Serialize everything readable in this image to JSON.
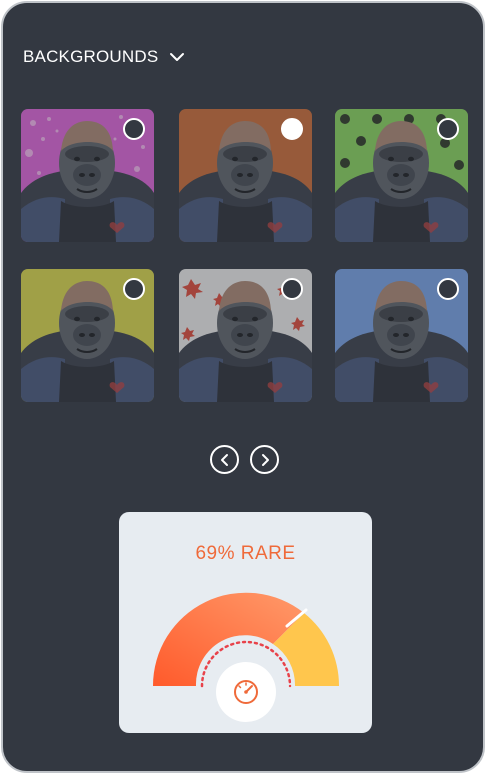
{
  "header": {
    "title": "BACKGROUNDS",
    "toggle_icon": "chevron-down-icon"
  },
  "backgrounds": [
    {
      "style": "pink-splatter",
      "color": "#c95fc6",
      "selected": false
    },
    {
      "style": "orange",
      "color": "#b86638",
      "selected": true
    },
    {
      "style": "green-polka-dot",
      "color": "#7ec05a",
      "selected": false
    },
    {
      "style": "yellow",
      "color": "#c5c34a",
      "selected": false
    },
    {
      "style": "maple-leaves",
      "color": "#d6d6d6",
      "selected": false
    },
    {
      "style": "blue",
      "color": "#6f95d1",
      "selected": false
    }
  ],
  "pagination": {
    "prev_icon": "chevron-left-icon",
    "next_icon": "chevron-right-icon"
  },
  "rarity": {
    "label": "69% RARE",
    "percent": 69,
    "icon": "speedometer-icon",
    "accent": "#ef6a3a"
  },
  "colors": {
    "panel": "#333841",
    "card": "#e7ecf1",
    "gauge_start": "#ff5d2a",
    "gauge_end": "#ffc64d"
  }
}
